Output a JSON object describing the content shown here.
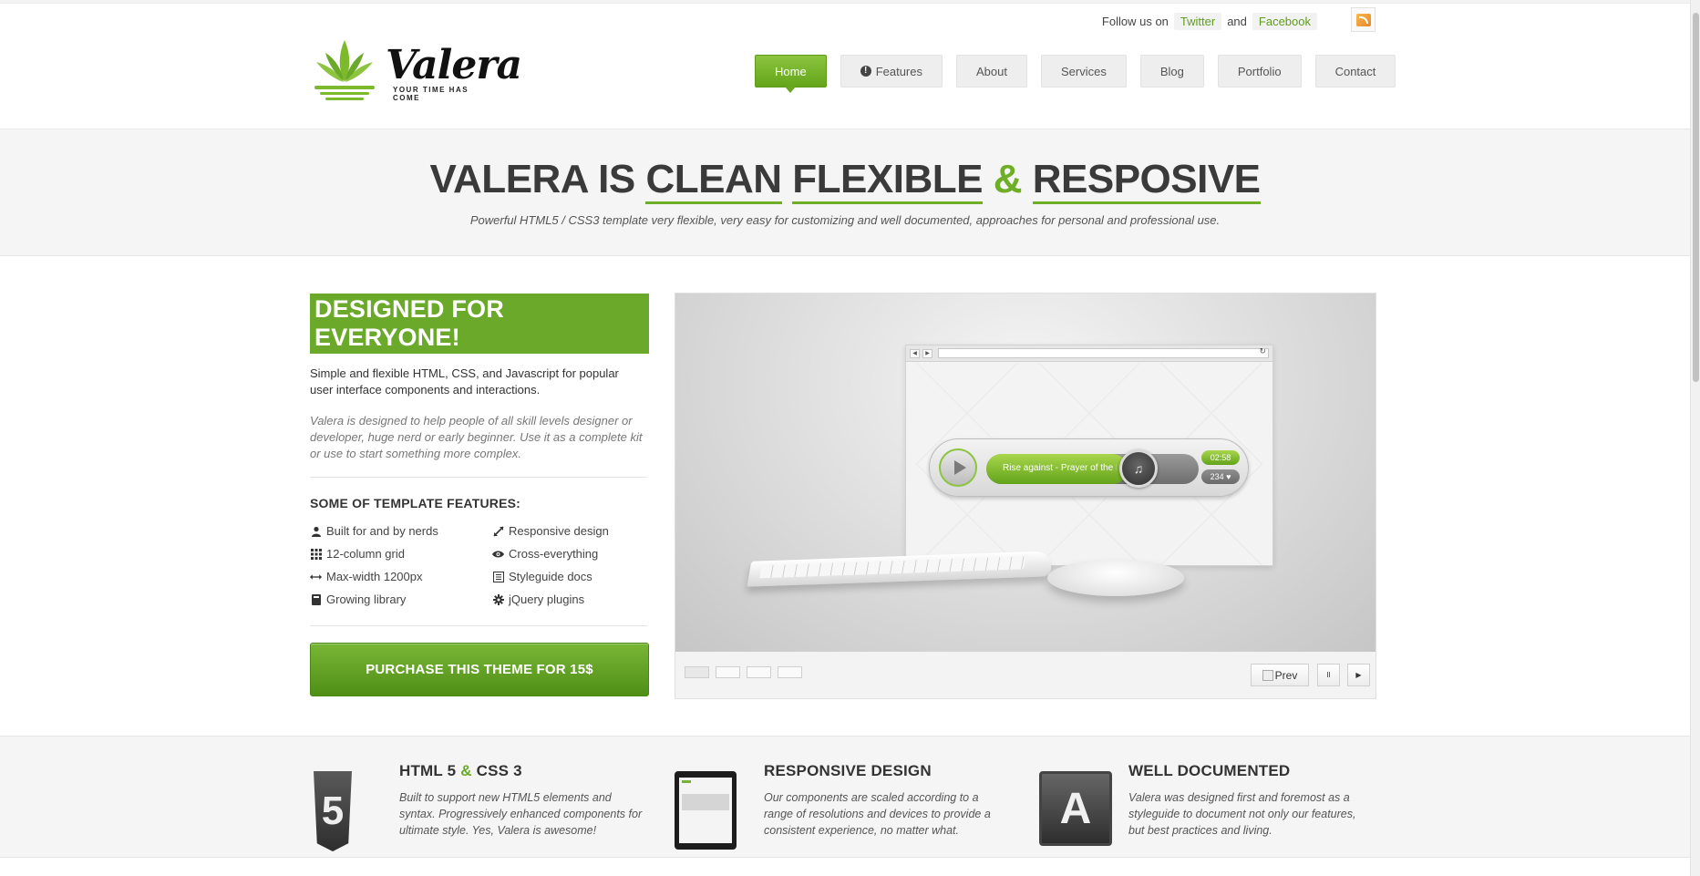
{
  "topbar": {
    "follow_text": "Follow us on",
    "and_text": "and",
    "twitter_label": "Twitter",
    "facebook_label": "Facebook"
  },
  "logo": {
    "word": "Valera",
    "tagline": "YOUR TIME HAS COME"
  },
  "nav": [
    {
      "label": "Home",
      "active": true
    },
    {
      "label": "Features",
      "icon": "exclamation-icon"
    },
    {
      "label": "About"
    },
    {
      "label": "Services"
    },
    {
      "label": "Blog"
    },
    {
      "label": "Portfolio"
    },
    {
      "label": "Contact"
    }
  ],
  "hero": {
    "title_parts": [
      "VALERA IS",
      "CLEAN",
      "FLEXIBLE",
      "&",
      "RESPOSIVE"
    ],
    "subtitle": "Powerful HTML5 / CSS3 template very flexible, very easy for customizing and well documented, approaches for personal and professional use."
  },
  "left": {
    "heading": "DESIGNED FOR EVERYONE!",
    "intro": "Simple and flexible HTML, CSS, and Javascript for popular user interface components and interactions.",
    "intro_italic": "Valera is designed to help people of all skill levels designer or developer, huge nerd or early beginner. Use it as a complete kit or use to start something more complex.",
    "features_title": "SOME OF TEMPLATE FEATURES:",
    "features": [
      {
        "label": "Built for and by nerds",
        "icon": "user-icon"
      },
      {
        "label": "Responsive design",
        "icon": "resize-icon"
      },
      {
        "label": "12-column grid",
        "icon": "grid-icon"
      },
      {
        "label": "Cross-everything",
        "icon": "eye-icon"
      },
      {
        "label": "Max-width 1200px",
        "icon": "horizontal-arrows-icon"
      },
      {
        "label": "Styleguide docs",
        "icon": "list-icon"
      },
      {
        "label": "Growing library",
        "icon": "book-icon"
      },
      {
        "label": "jQuery plugins",
        "icon": "cog-icon"
      }
    ],
    "purchase_label": "PURCHASE THIS THEME FOR 15$"
  },
  "slider": {
    "player_track": "Rise against - Prayer of the Refugee",
    "player_time": "02:58",
    "player_count": "234 ♥",
    "prev_label": "Prev",
    "pause_glyph": "II",
    "next_glyph": "▶"
  },
  "band": [
    {
      "title_a": "HTML 5",
      "amp": "&",
      "title_b": "CSS 3",
      "text": "Built to support new HTML5 elements and syntax. Progressively enhanced components for ultimate style. Yes, Valera is awesome!",
      "icon_glyph": "5"
    },
    {
      "title": "RESPONSIVE DESIGN",
      "text": "Our components are scaled according to a range of resolutions and devices to provide a consistent experience, no matter what."
    },
    {
      "title": "WELL DOCUMENTED",
      "text": "Valera was designed first and foremost as a styleguide to document not only our features, but best practices and living.",
      "icon_glyph": "A"
    }
  ],
  "colors": {
    "accent_green": "#6aa92a",
    "text_dark": "#3a3a3a"
  }
}
